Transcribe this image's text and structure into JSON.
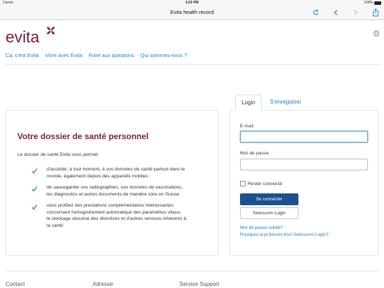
{
  "status_bar": {
    "carrier": "Carrier",
    "time": "3:03 PM",
    "battery": "100%"
  },
  "nav_bar": {
    "title": "Evita health record",
    "icons": [
      "reload-icon",
      "back-icon",
      "forward-icon",
      "share-icon"
    ]
  },
  "header": {
    "logo_text": "evita",
    "brand_color": "#7a1f3e",
    "accent_color": "#1b7ec2",
    "nav": [
      "Ca, c'est Evita",
      "Vivre avec Evita",
      "Foire aux questions",
      "Qui sommes-nous ?"
    ]
  },
  "info": {
    "title": "Votre dossier de santé personnel",
    "lead": "Le dossier de santé Evita vous permet",
    "benefits": [
      {
        "lines": [
          "d'accéder, à tout moment, à vos données de santé partout dans le",
          "monde, également depuis des appareils mobiles"
        ]
      },
      {
        "lines": [
          "de sauvegarder vos radiographies, vos données de vaccinations,",
          "les diagnostics et autres documents de manière sûre en Suisse"
        ]
      },
      {
        "lines": [
          "vous profitez des prestations complémentaires intéressantes",
          "concernant l'enregistrement automatique des paramètres vitaux,",
          "le stockage sécurisé des directives et d'autres services inhérents à",
          "la santé"
        ]
      }
    ]
  },
  "tabs": {
    "login": "Login",
    "register": "S'enregistrer"
  },
  "login": {
    "email_label": "E-mail",
    "email_value": "",
    "password_label": "Mot de passe",
    "password_value": "",
    "remember_label": "Rester connecté",
    "remember_checked": false,
    "submit_label": "Se connecter",
    "swisscom_label": "Swisscom Login",
    "forgot_link": "Mot de passe oublié?",
    "why_link": "Pourquoi ai-je besoin d'un Swisscom Login?"
  },
  "footer": {
    "columns": [
      "Contact",
      "Adresse",
      "Service Support"
    ]
  }
}
